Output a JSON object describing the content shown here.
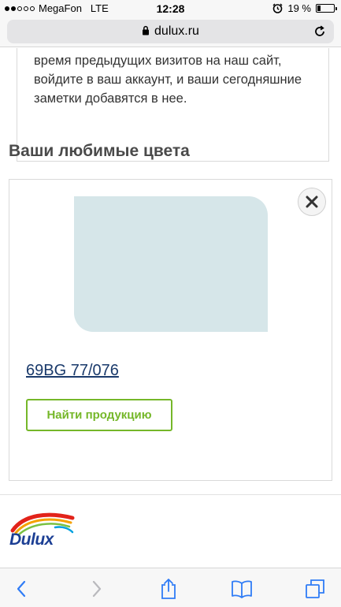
{
  "status_bar": {
    "carrier": "MegaFon",
    "network": "LTE",
    "time": "12:28",
    "battery": "19 %",
    "battery_level": 0.19,
    "signal_bars_filled": 2,
    "signal_bars_total": 5
  },
  "browser": {
    "url": "dulux.ru"
  },
  "note": {
    "text": "время предыдущих визитов на наш сайт, войдите в ваш аккаунт, и ваши сегодняшние заметки добавятся в нее."
  },
  "favorites": {
    "title": "Ваши любимые цвета",
    "items": [
      {
        "color_code": "69BG 77/076",
        "swatch_color": "#d6e6e9",
        "find_button": "Найти продукцию"
      }
    ]
  },
  "footer": {
    "logo_text": "Dulux"
  },
  "colors": {
    "accent_green": "#75b729",
    "link_blue": "#1a3a6b",
    "ios_blue": "#2f7cf6",
    "brand_blue": "#1c3f94"
  },
  "icons": {
    "close": "close-icon",
    "lock": "lock-icon",
    "reload": "reload-icon",
    "back": "chevron-left-icon",
    "forward": "chevron-right-icon",
    "share": "share-icon",
    "bookmarks": "book-icon",
    "tabs": "tabs-icon"
  }
}
